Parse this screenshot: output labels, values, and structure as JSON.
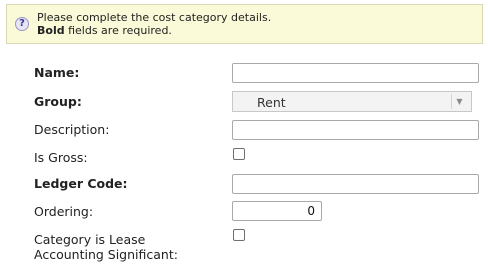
{
  "notice": {
    "line1": "Please complete the cost category details.",
    "line2_bold": "Bold",
    "line2_rest": " fields are required."
  },
  "form": {
    "name_label": "Name:",
    "group_label": "Group:",
    "group_value": "Rent",
    "description_label": "Description:",
    "is_gross_label": "Is Gross:",
    "ledger_code_label": "Ledger Code:",
    "ordering_label": "Ordering:",
    "ordering_value": "0",
    "lease_label_line1": "Category is Lease",
    "lease_label_line2": "Accounting Significant:"
  }
}
